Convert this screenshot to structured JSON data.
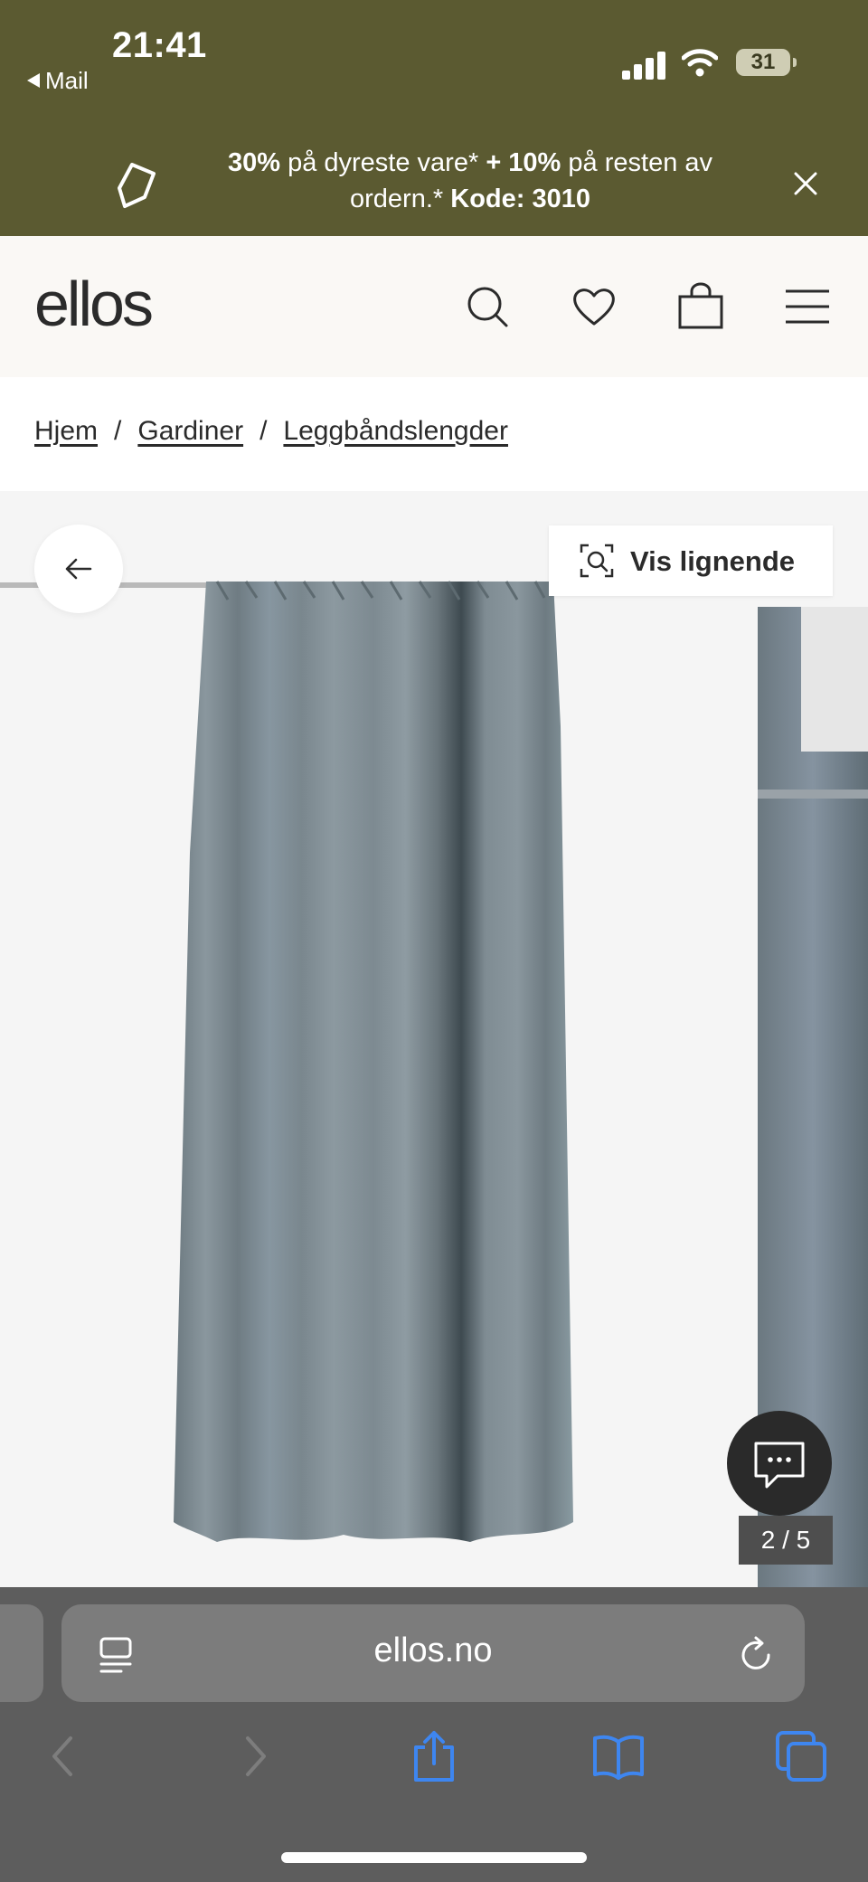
{
  "status_bar": {
    "time": "21:41",
    "back_app": "Mail",
    "battery": "31"
  },
  "promo": {
    "part1_bold": "30%",
    "part2": " på dyreste vare* ",
    "part3_bold": "+ 10%",
    "part4": " på resten av ordern.* ",
    "part5_bold": "Kode: 3010"
  },
  "header": {
    "logo": "ellos"
  },
  "breadcrumb": {
    "items": [
      "Hjem",
      "Gardiner",
      "Leggbåndslengder"
    ],
    "separator": "/"
  },
  "gallery": {
    "similar_label": "Vis lignende",
    "counter": "2 / 5",
    "curtain_color": "#7d8a91"
  },
  "browser": {
    "url": "ellos.no"
  },
  "colors": {
    "promo_bg": "#5b5a31",
    "accent_blue": "#3e86f0"
  }
}
